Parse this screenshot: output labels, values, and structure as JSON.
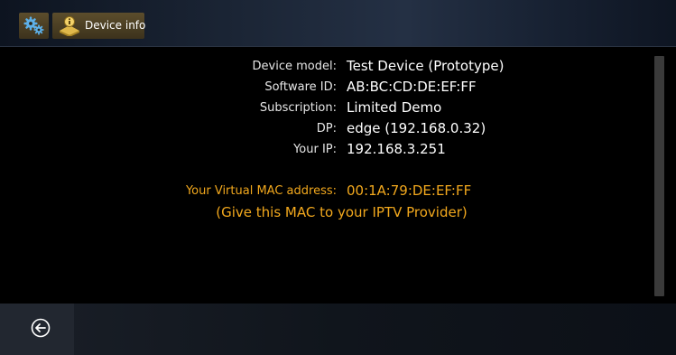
{
  "toolbar": {
    "settings_icon": "gears-icon",
    "device_info_icon": "device-info-icon",
    "device_info_label": "Device info"
  },
  "device_info": {
    "rows": [
      {
        "label": "Device model:",
        "value": "Test Device (Prototype)"
      },
      {
        "label": "Software ID:",
        "value": "AB:BC:CD:DE:EF:FF"
      },
      {
        "label": "Subscription:",
        "value": "Limited Demo"
      },
      {
        "label": "DP:",
        "value": "edge (192.168.0.32)"
      },
      {
        "label": "Your IP:",
        "value": "192.168.3.251"
      }
    ],
    "mac_label": "Your Virtual MAC address:",
    "mac_value": "00:1A:79:DE:EF:FF",
    "mac_note": "(Give this MAC to your IPTV Provider)"
  },
  "footer": {
    "back_icon": "back-arrow-icon"
  },
  "colors": {
    "accent": "#f2a81d",
    "button_bg": "#4c3f24",
    "background": "#000000"
  }
}
